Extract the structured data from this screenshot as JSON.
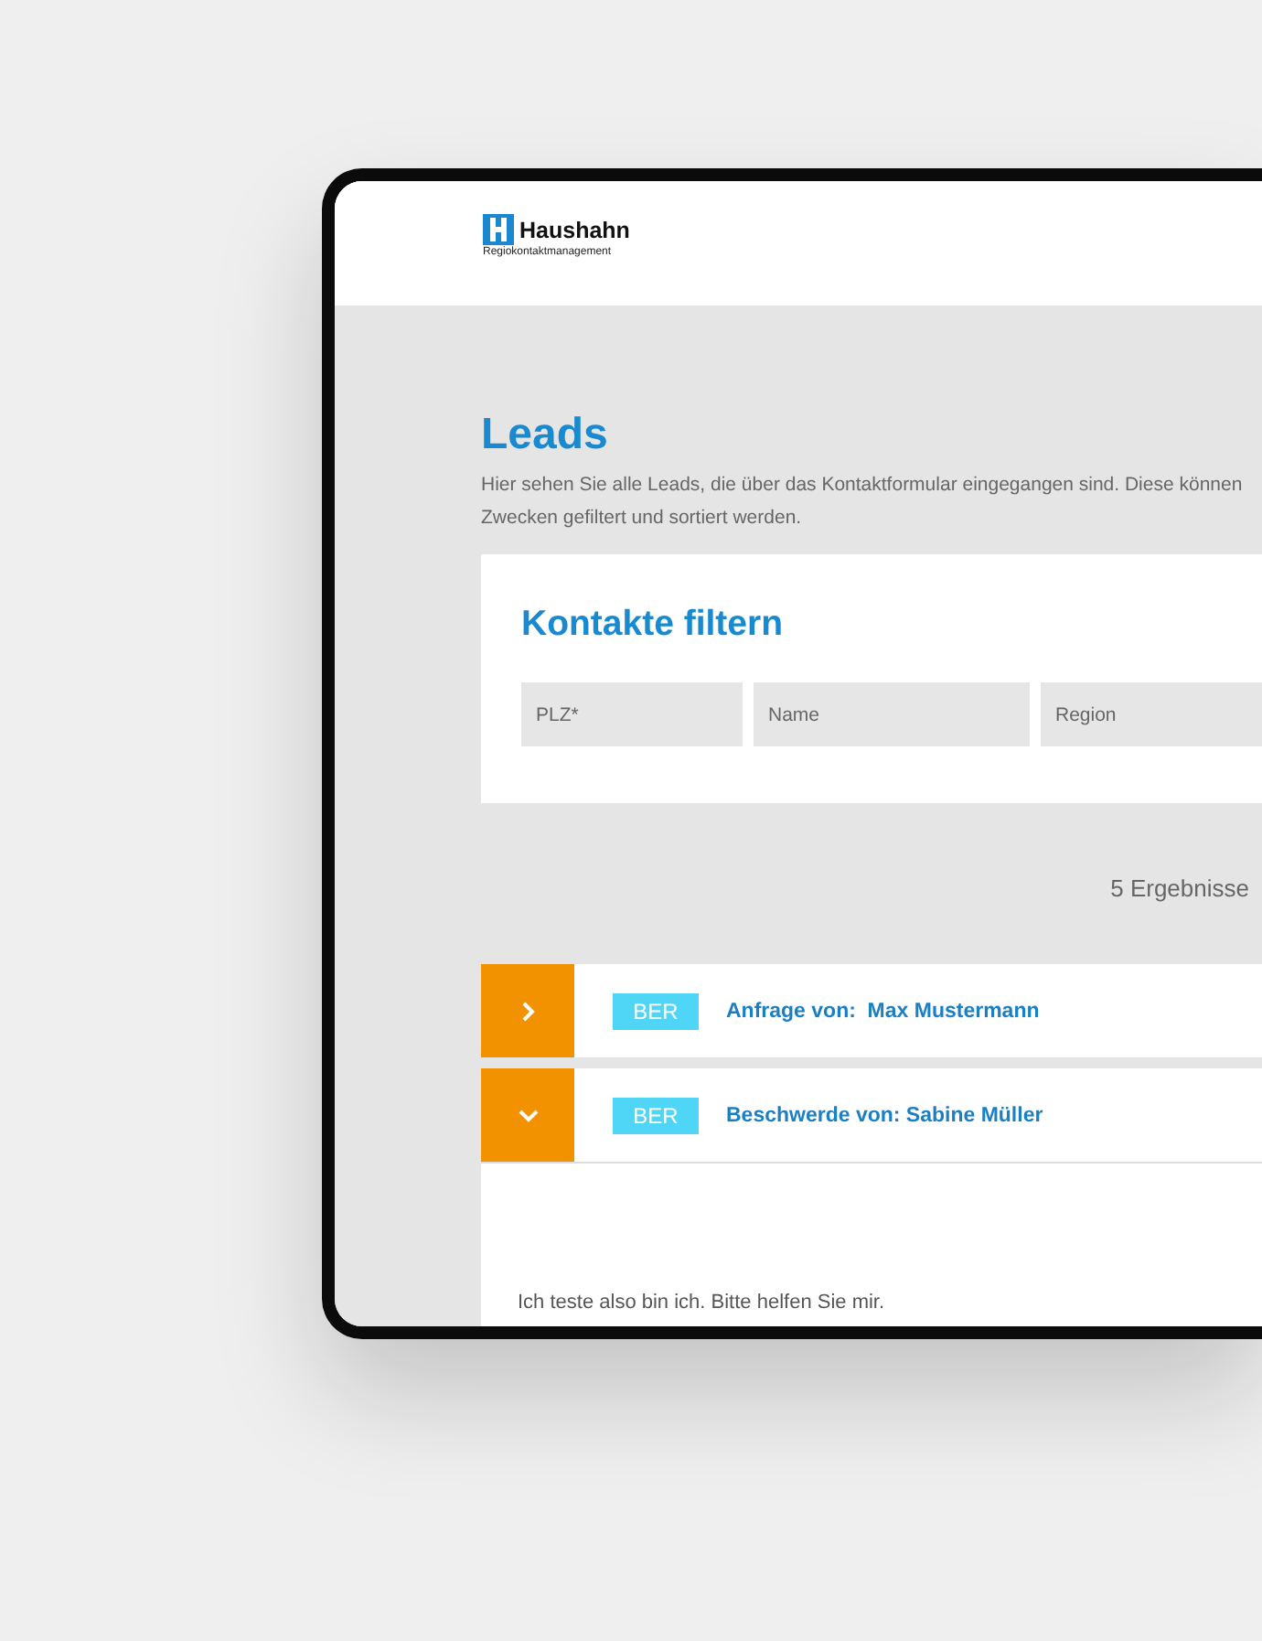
{
  "header": {
    "brand": "Haushahn",
    "tagline": "Regiokontaktmanagement"
  },
  "page": {
    "title": "Leads",
    "description": "Hier sehen Sie alle Leads, die über das Kontaktformular eingegangen sind. Diese können\nZwecken gefiltert und sortiert werden."
  },
  "filter": {
    "title": "Kontakte filtern",
    "fields": [
      {
        "placeholder": "PLZ*"
      },
      {
        "placeholder": "Name"
      },
      {
        "placeholder": "Region"
      }
    ]
  },
  "results": "5 Ergebnisse",
  "leads": [
    {
      "badge": "BER",
      "title": "Anfrage von:  Max Mustermann",
      "expanded": false
    },
    {
      "badge": "BER",
      "title": "Beschwerde von: Sabine Müller",
      "expanded": true,
      "body": "Ich teste also bin ich. Bitte helfen Sie mir."
    }
  ]
}
